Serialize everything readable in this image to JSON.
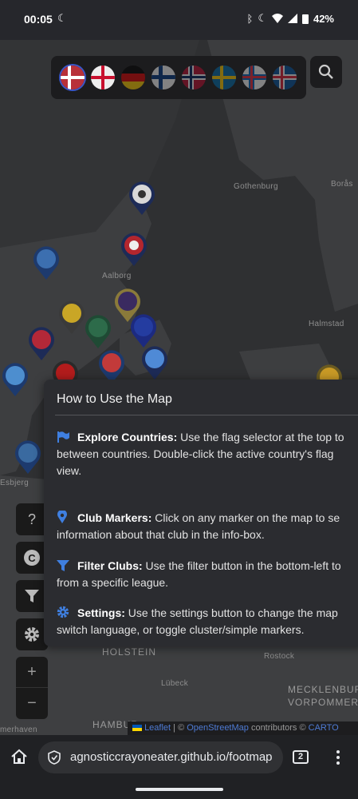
{
  "status_bar": {
    "time": "00:05",
    "battery": "42%"
  },
  "flags": [
    "Denmark",
    "England",
    "Germany",
    "Finland",
    "Norway",
    "Sweden",
    "Faroe Islands",
    "Iceland"
  ],
  "map_labels": {
    "gothenburg": "Gothenburg",
    "boras": "Borås",
    "aalborg": "Aalborg",
    "halmstad": "Halmstad",
    "esbjerg": "Esbjerg",
    "holstein": "HOLSTEIN",
    "rostock": "Rostock",
    "lubeck": "Lübeck",
    "mecklenburg": "MECKLENBURG",
    "vorpommern": "VORPOMMER",
    "bremerhaven": "merhaven",
    "hamburg": "HAMBUR"
  },
  "help": {
    "title": "How to Use the Map",
    "items": [
      {
        "icon": "flag-icon",
        "label": "Explore Countries:",
        "line1": " Use the flag selector at the top to",
        "line2": "between countries. Double-click the active country's flag",
        "line3": "view."
      },
      {
        "icon": "location-pin-icon",
        "label": "Club Markers:",
        "line1": " Click on any marker on the map to se",
        "line2": "information about that club in the info-box."
      },
      {
        "icon": "filter-icon",
        "label": "Filter Clubs:",
        "line1": " Use the filter button in the bottom-left to",
        "line2": "from a specific league."
      },
      {
        "icon": "gear-icon",
        "label": "Settings:",
        "line1": " Use the settings button to change the map",
        "line2": "switch language, or toggle cluster/simple markers."
      }
    ]
  },
  "controls": {
    "help": "?",
    "copyright": "C",
    "zoom_in": "+",
    "zoom_out": "−"
  },
  "attribution": {
    "leaflet": "Leaflet",
    "sep1": " | © ",
    "osm": "OpenStreetMap",
    "contrib": " contributors © ",
    "carto": "CARTO"
  },
  "browser": {
    "url": "agnosticcrayoneater.github.io/footmap",
    "tabs_count": "2"
  },
  "colors": {
    "accent_blue": "#3f7fe0",
    "link_blue": "#4e7bd4"
  }
}
